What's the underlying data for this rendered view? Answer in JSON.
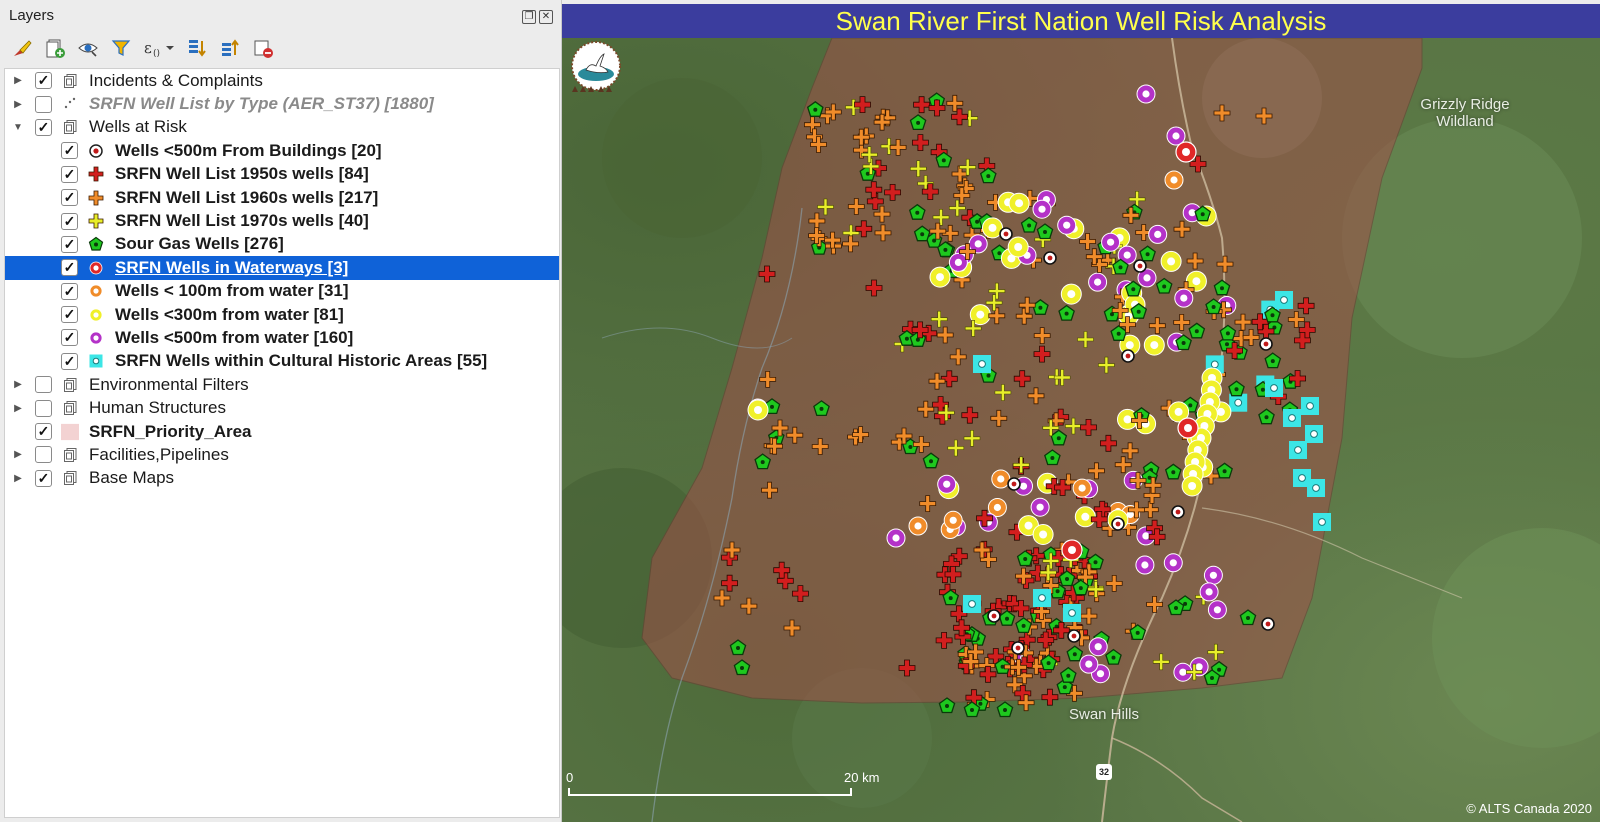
{
  "panel": {
    "title": "Layers",
    "title_buttons": [
      "restore-icon",
      "close-icon"
    ],
    "toolbar": [
      "style-icon",
      "add-group-icon",
      "visibility-icon",
      "filter-icon",
      "expression-icon",
      "expand-all-icon",
      "collapse-all-icon",
      "remove-layer-icon"
    ]
  },
  "layers": [
    {
      "label": "Incidents & Complaints",
      "level": 0,
      "expander": "collapsed",
      "checked": true,
      "icon": "group-icon",
      "style": "normal"
    },
    {
      "label": "SRFN Well List by Type (AER_ST37) [1880]",
      "level": 0,
      "expander": "collapsed",
      "checked": false,
      "icon": "point-layer-icon",
      "style": "grey"
    },
    {
      "label": "Wells at Risk",
      "level": 0,
      "expander": "expanded",
      "checked": true,
      "icon": "group-icon",
      "style": "normal"
    },
    {
      "label": "Wells <500m From Buildings [20]",
      "level": 1,
      "checked": true,
      "icon": "sym-bullseye-dark",
      "style": "bold"
    },
    {
      "label": "SRFN Well List 1950s wells [84]",
      "level": 1,
      "checked": true,
      "icon": "sym-cross-red",
      "style": "bold"
    },
    {
      "label": "SRFN Well List 1960s wells [217]",
      "level": 1,
      "checked": true,
      "icon": "sym-cross-orange",
      "style": "bold"
    },
    {
      "label": "SRFN Well List 1970s wells [40]",
      "level": 1,
      "checked": true,
      "icon": "sym-cross-yellow",
      "style": "bold"
    },
    {
      "label": "Sour Gas Wells [276]",
      "level": 1,
      "checked": true,
      "icon": "sym-pentagon-green",
      "style": "bold"
    },
    {
      "label": "SRFN Wells in Waterways [3]",
      "level": 1,
      "checked": true,
      "icon": "sym-ring-red",
      "style": "bold",
      "selected": true
    },
    {
      "label": "Wells < 100m from water [31]",
      "level": 1,
      "checked": true,
      "icon": "sym-ring-orange",
      "style": "bold"
    },
    {
      "label": "Wells <300m from water [81]",
      "level": 1,
      "checked": true,
      "icon": "sym-ring-yellow",
      "style": "bold"
    },
    {
      "label": "Wells <500m from water [160]",
      "level": 1,
      "checked": true,
      "icon": "sym-ring-purple",
      "style": "bold"
    },
    {
      "label": "SRFN Wells within Cultural Historic Areas [55]",
      "level": 1,
      "checked": true,
      "icon": "sym-square-cyan",
      "style": "bold"
    },
    {
      "label": "Environmental Filters",
      "level": 0,
      "expander": "collapsed",
      "checked": false,
      "icon": "group-icon",
      "style": "normal"
    },
    {
      "label": "Human Structures",
      "level": 0,
      "expander": "collapsed",
      "checked": false,
      "icon": "group-icon",
      "style": "normal"
    },
    {
      "label": "SRFN_Priority_Area",
      "level": 0,
      "checked": true,
      "icon": "polygon-swatch",
      "style": "bold"
    },
    {
      "label": "Facilities,Pipelines",
      "level": 0,
      "expander": "collapsed",
      "checked": false,
      "icon": "group-icon",
      "style": "normal"
    },
    {
      "label": "Base Maps",
      "level": 0,
      "expander": "collapsed",
      "checked": true,
      "icon": "group-icon",
      "style": "normal"
    }
  ],
  "map": {
    "title": "Swan River First Nation Well Risk Analysis",
    "place_labels": [
      "Grizzly Ridge Wildland",
      "Swan Hills"
    ],
    "highway_shield": "32",
    "scale_start": "0",
    "scale_end": "20 km",
    "copyright": "© ALTS Canada 2020"
  },
  "colors": {
    "selection": "#0f62d8",
    "title_bar": "#3b3d9e",
    "title_text": "#ffff4c",
    "priority_area": "#a0504a",
    "cross_red": "#d21e1e",
    "cross_orange": "#f08c2a",
    "cross_yellow": "#e8ee2a",
    "pentagon_green": "#1ec81e",
    "ring_orange": "#f08c2a",
    "ring_yellow": "#f0f02a",
    "ring_purple": "#b432c8",
    "square_cyan": "#3ce6e6"
  }
}
